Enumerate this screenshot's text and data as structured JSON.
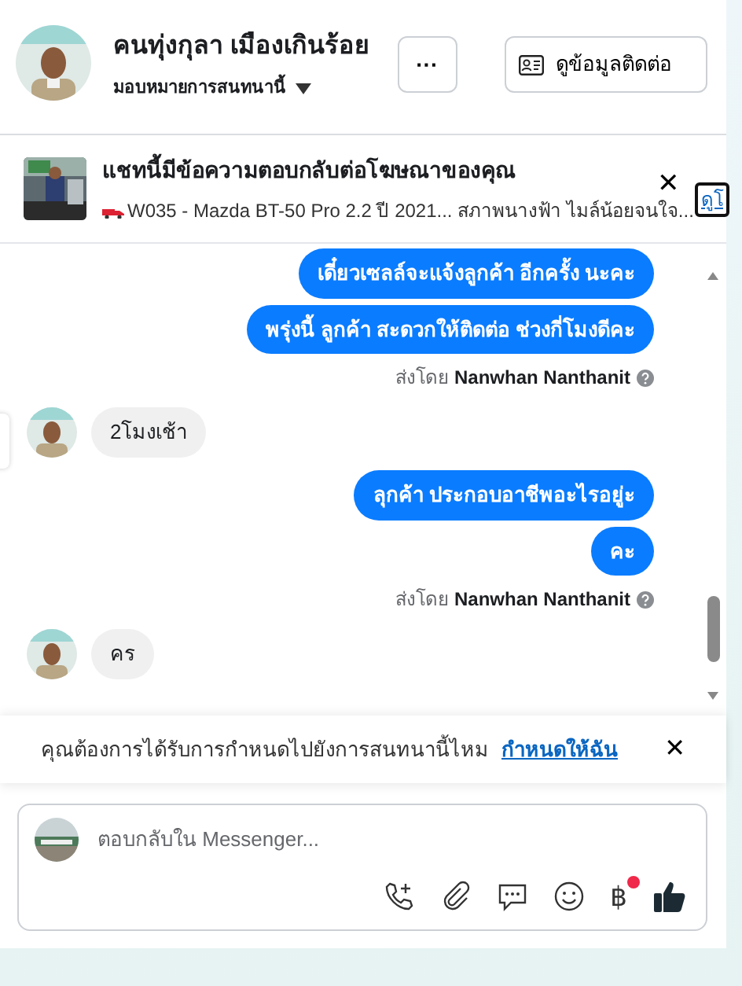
{
  "header": {
    "name": "คนทุ่งกุลา เมืองเกินร้อย",
    "assign_label": "มอบหมายการสนทนานี้",
    "more_button": "···",
    "contact_button": "ดูข้อมูลติดต่อ"
  },
  "ad_banner": {
    "title": "แชทนี้มีข้อความตอบกลับต่อโฆษณาของคุณ",
    "subtitle": "W035 - Mazda BT-50 Pro 2.2 ปี 2021... สภาพนางฟ้า ไมล์น้อยจนใจ...",
    "close": "✕",
    "link": "ดูโ"
  },
  "messages": [
    {
      "kind": "outgoing",
      "text": "เดี๋ยวเซลล์จะแจ้งลูกค้า อีกครั้ง นะคะ"
    },
    {
      "kind": "outgoing",
      "text": "พรุ่งนี้ ลูกค้า สะดวกให้ติดต่อ ช่วงกี่โมงดีคะ"
    },
    {
      "kind": "sent_by",
      "label": "ส่งโดย",
      "sender": "Nanwhan Nanthanit"
    },
    {
      "kind": "incoming",
      "text": "2โมงเช้า"
    },
    {
      "kind": "outgoing",
      "text": "ลุกค้า  ประกอบอาชีพอะไรอยู่ะ"
    },
    {
      "kind": "outgoing",
      "text": "คะ"
    },
    {
      "kind": "sent_by",
      "label": "ส่งโดย",
      "sender": "Nanwhan Nanthanit"
    },
    {
      "kind": "incoming",
      "text": "คร"
    }
  ],
  "assign_prompt": {
    "text": "คุณต้องการได้รับการกำหนดไปยังการสนทนานี้ไหม",
    "link": "กำหนดให้ฉัน",
    "close": "✕"
  },
  "composer": {
    "placeholder": "ตอบกลับใน Messenger...",
    "currency_symbol": "฿",
    "currency_notification": true
  }
}
